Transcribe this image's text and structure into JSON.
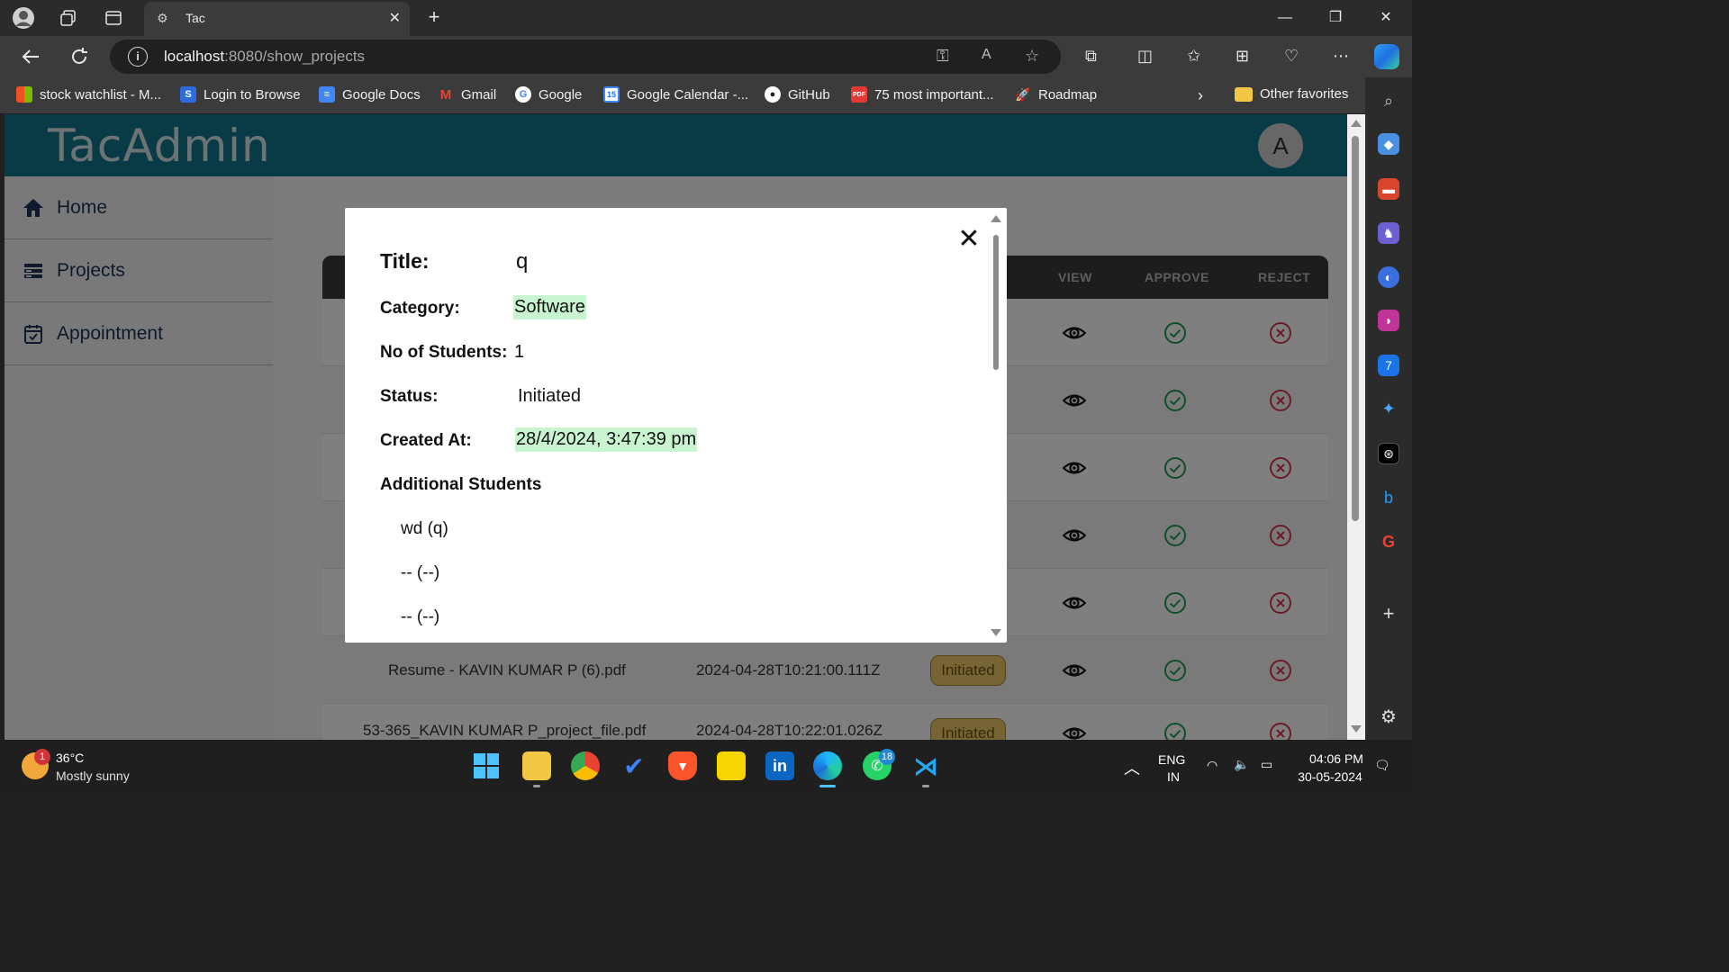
{
  "browser": {
    "tab_title": "Tac",
    "url_host": "localhost",
    "url_rest": ":8080/show_projects",
    "bookmarks": [
      {
        "label": "stock watchlist - M...",
        "icon": "microsoft-icon",
        "color": "#f25022"
      },
      {
        "label": "Login to Browse",
        "icon": "s-icon",
        "color": "#2d6cdf"
      },
      {
        "label": "Google Docs",
        "icon": "docs-icon",
        "color": "#4285f4"
      },
      {
        "label": "Gmail",
        "icon": "gmail-icon",
        "color": "#ea4335"
      },
      {
        "label": "Google",
        "icon": "google-icon",
        "color": "#ffffff"
      },
      {
        "label": "Google Calendar -...",
        "icon": "calendar-icon",
        "color": "#4285f4"
      },
      {
        "label": "GitHub",
        "icon": "github-icon",
        "color": "#ffffff"
      },
      {
        "label": "75 most important...",
        "icon": "pdf-icon",
        "color": "#e53935"
      },
      {
        "label": "Roadmap",
        "icon": "rocket-icon",
        "color": "#ffffff"
      }
    ],
    "other_favorites": "Other favorites"
  },
  "app": {
    "logo": "TacAdmin",
    "avatar_letter": "A",
    "nav": [
      {
        "label": "Home",
        "icon": "home-icon"
      },
      {
        "label": "Projects",
        "icon": "projects-icon"
      },
      {
        "label": "Appointment",
        "icon": "calendar-check-icon"
      }
    ],
    "table": {
      "headers": [
        "VIEW",
        "APPROVE",
        "REJECT"
      ],
      "visible_row": {
        "file": "Resume - KAVIN KUMAR P (6).pdf",
        "created": "2024-04-28T10:21:00.111Z",
        "status": "Initiated"
      },
      "partial_row": {
        "file": "53-365_KAVIN KUMAR P_project_file.pdf",
        "created": "2024-04-28T10:22:01.026Z",
        "status": "Initiated"
      }
    }
  },
  "modal": {
    "title_label": "Title:",
    "title_value": "q",
    "category_label": "Category:",
    "category_value": "Software",
    "students_label": "No of Students:",
    "students_value": "1",
    "status_label": "Status:",
    "status_value": "Initiated",
    "created_label": "Created At:",
    "created_value": "28/4/2024, 3:47:39 pm",
    "additional_heading": "Additional Students",
    "additional": [
      "wd (q)",
      "-- (--)",
      "-- (--)"
    ]
  },
  "taskbar": {
    "weather_temp": "36°C",
    "weather_desc": "Mostly sunny",
    "weather_badge": "1",
    "whatsapp_badge": "18",
    "lang_top": "ENG",
    "lang_bottom": "IN",
    "time": "04:06 PM",
    "date": "30-05-2024"
  }
}
